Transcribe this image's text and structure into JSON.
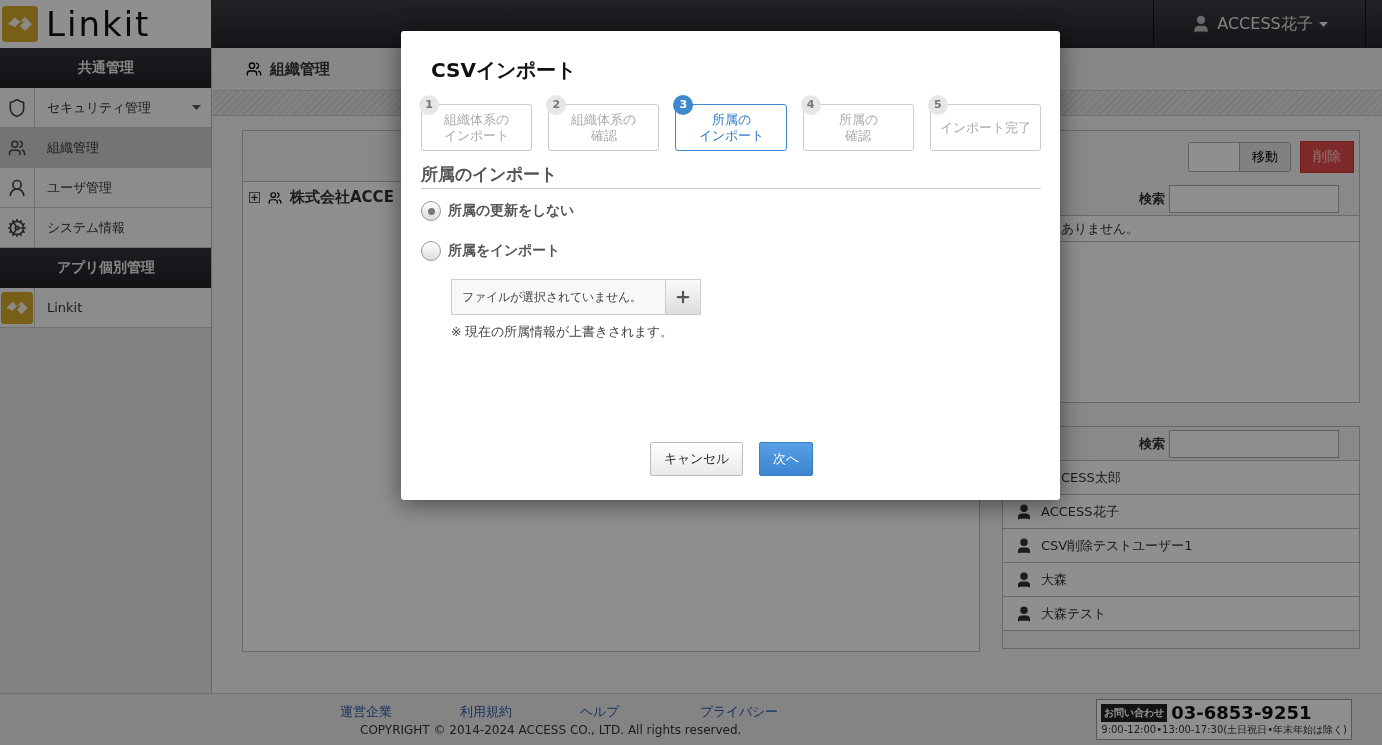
{
  "header": {
    "logo": "Linkit",
    "user_menu": "ACCESS花子"
  },
  "sidebar": {
    "sections": [
      {
        "title": "共通管理",
        "items": [
          {
            "label": "セキュリティ管理",
            "selected": false,
            "expandable": true
          },
          {
            "label": "組織管理",
            "selected": true,
            "expandable": false
          },
          {
            "label": "ユーザ管理",
            "selected": false,
            "expandable": false
          },
          {
            "label": "システム情報",
            "selected": false,
            "expandable": false
          }
        ]
      },
      {
        "title": "アプリ個別管理",
        "items": [
          {
            "label": "Linkit",
            "selected": false,
            "expandable": false
          }
        ]
      }
    ]
  },
  "page": {
    "title": "組織管理",
    "tree": {
      "root": "株式会社ACCE",
      "expanded": false
    },
    "members_panel": {
      "move_button": "移動",
      "delete_button": "削除",
      "search_label": "検索",
      "message": "ありません。"
    },
    "users_panel": {
      "search_label": "検索",
      "users": [
        {
          "name": "CESS太郎",
          "cut": true
        },
        {
          "name": "ACCESS花子",
          "cut": false
        },
        {
          "name": "CSV削除テストユーザー1",
          "cut": false
        },
        {
          "name": "大森",
          "cut": false
        },
        {
          "name": "大森テスト",
          "cut": false
        }
      ]
    }
  },
  "dialog": {
    "title": "CSVインポート",
    "steps": [
      {
        "number": "1",
        "lines": [
          "組織体系の",
          "インポート"
        ],
        "selected": false
      },
      {
        "number": "2",
        "lines": [
          "組織体系の",
          "確認"
        ],
        "selected": false
      },
      {
        "number": "3",
        "lines": [
          "所属の",
          "インポート"
        ],
        "selected": true
      },
      {
        "number": "4",
        "lines": [
          "所属の",
          "確認"
        ],
        "selected": false
      },
      {
        "number": "5",
        "lines": [
          "インポート完了"
        ],
        "selected": false
      }
    ],
    "section_title": "所属のインポート",
    "options": [
      {
        "label": "所属の更新をしない",
        "selected": true
      },
      {
        "label": "所属をインポート",
        "selected": false
      }
    ],
    "file_status": "ファイルが選択されていません。",
    "note": "※ 現在の所属情報が上書きされます。",
    "buttons": [
      {
        "label": "キャンセル",
        "kind": "secondary"
      },
      {
        "label": "次へ",
        "kind": "primary"
      }
    ]
  },
  "footer": {
    "links": [
      "運営企業",
      "利用規約",
      "ヘルプ",
      "プライバシー"
    ],
    "copyright": "COPYRIGHT © 2014-2024 ACCESS CO., LTD. All rights reserved.",
    "contact": {
      "badge": "お問い合わせ",
      "phone": "03-6853-9251",
      "hours": "9:00-12:00•13:00-17:30(土日祝日•年末年始は除く)"
    }
  }
}
